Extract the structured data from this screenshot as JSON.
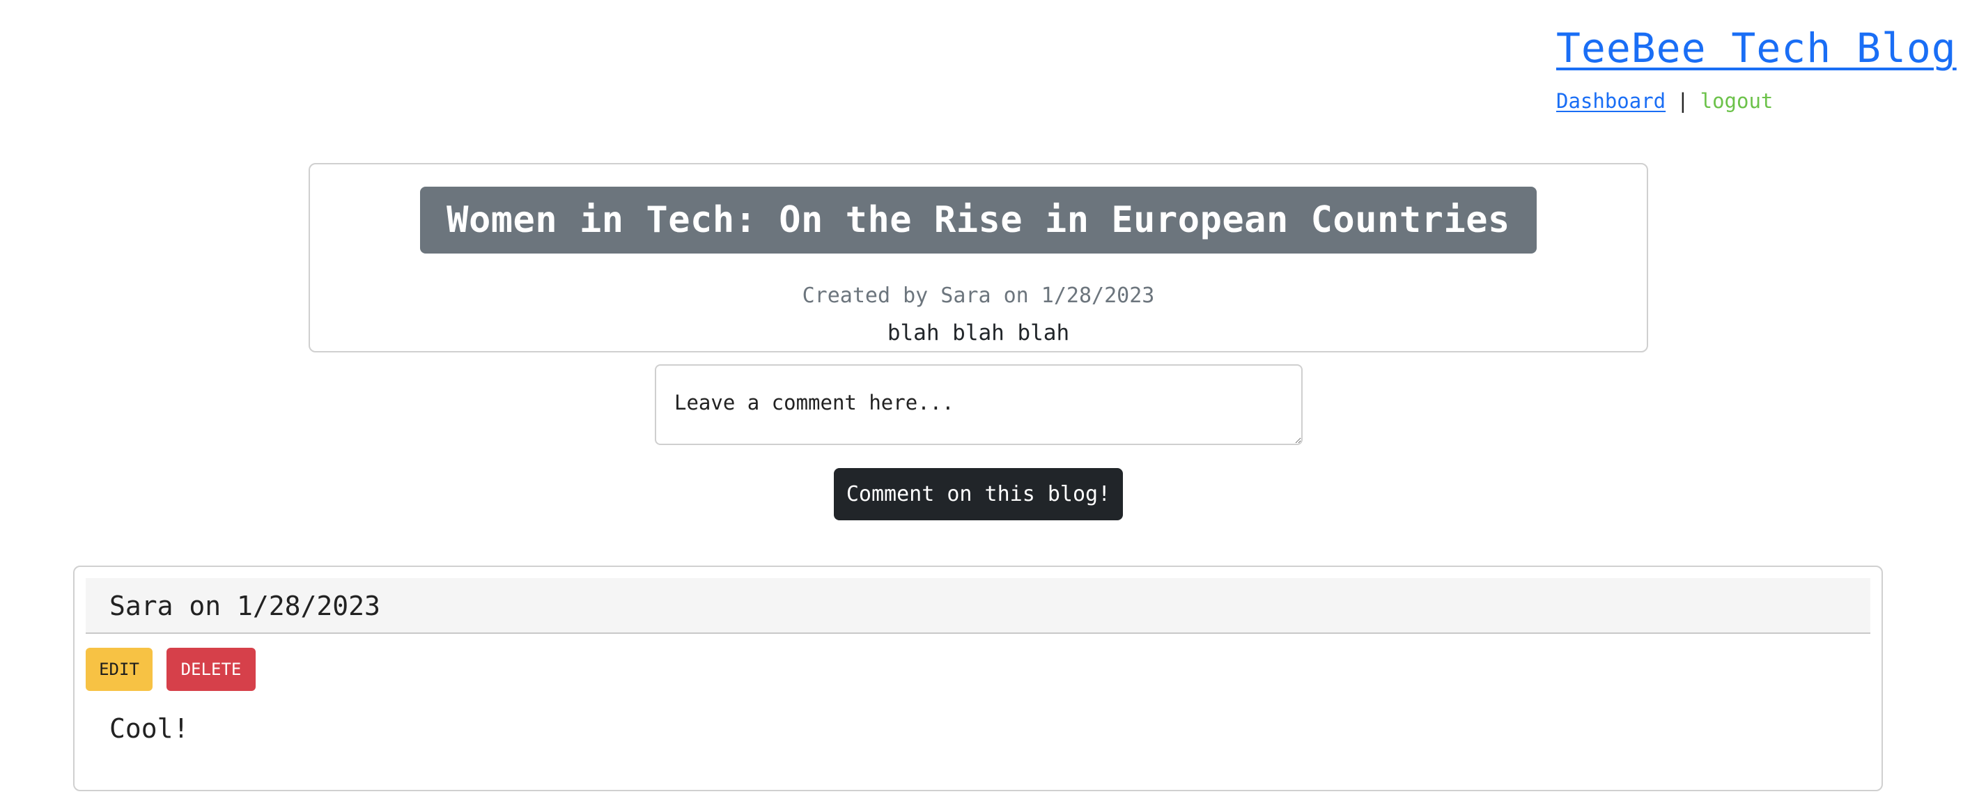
{
  "header": {
    "site_title": "TeeBee Tech Blog",
    "nav": {
      "dashboard": "Dashboard",
      "separator": "|",
      "logout": "logout"
    }
  },
  "post": {
    "title": "Women in Tech: On the Rise in European Countries",
    "meta": "Created by Sara on 1/28/2023",
    "body": "blah blah blah"
  },
  "comment_form": {
    "placeholder": "Leave a comment here...",
    "submit_label": "Comment on this blog!"
  },
  "comments": [
    {
      "header": "Sara on 1/28/2023",
      "edit_label": "EDIT",
      "delete_label": "DELETE",
      "text": "Cool!"
    }
  ],
  "colors": {
    "link": "#1a6ef5",
    "logout": "#6cc24a",
    "title_bg": "#6c757d",
    "button_dark": "#212529",
    "edit": "#f7c244",
    "delete": "#d6404a"
  }
}
